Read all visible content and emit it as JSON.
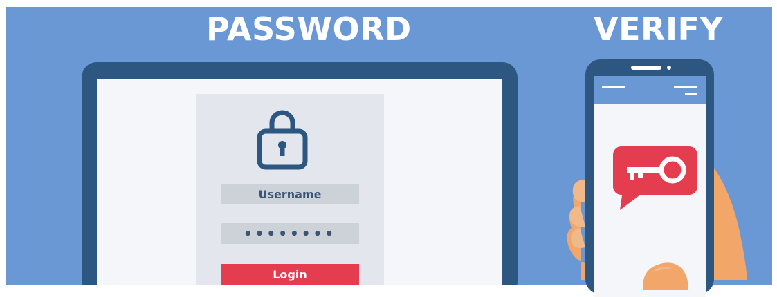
{
  "headings": {
    "password": "PASSWORD",
    "verify": "VERIFY"
  },
  "login_form": {
    "username_label": "Username",
    "password_mask": "••••••••",
    "login_button": "Login"
  },
  "colors": {
    "background": "#6a98d4",
    "device_frame": "#2d5680",
    "screen": "#f4f6fa",
    "panel": "#e3e6ec",
    "field": "#cdd1d8",
    "accent_red": "#e43d4f",
    "skin": "#f2a66a"
  },
  "icons": [
    "lock-icon",
    "key-icon",
    "chat-bubble-icon"
  ]
}
